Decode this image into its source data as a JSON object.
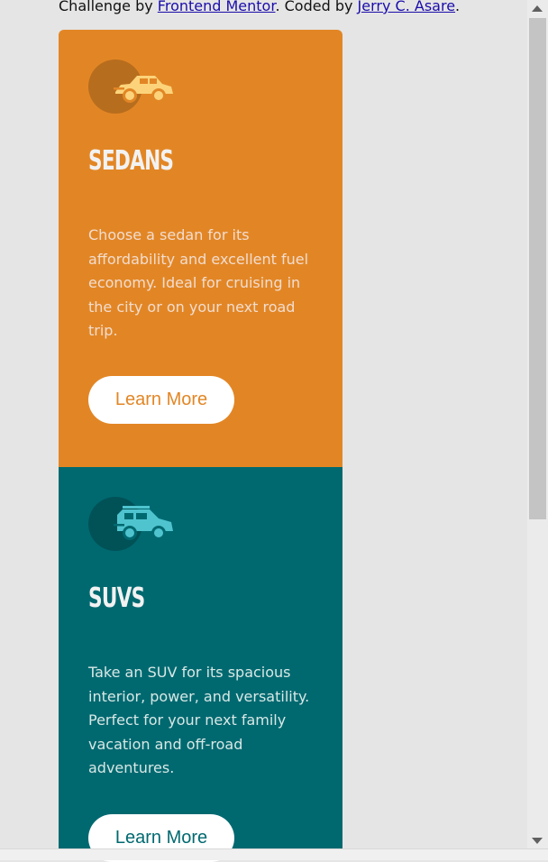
{
  "attribution": {
    "prefix": "Challenge by ",
    "link1": "Frontend Mentor",
    "middle": ". Coded by ",
    "link2": "Jerry C. Asare",
    "suffix": "."
  },
  "cards": [
    {
      "title": "SEDANS",
      "text": "Choose a sedan for its affordability and excellent fuel economy. Ideal for cruising in the city or on your next road trip.",
      "button": "Learn More",
      "icon": "sedan-car-icon",
      "color": "#e28625"
    },
    {
      "title": "SUVS",
      "text": "Take an SUV for its spacious interior, power, and versatility. Perfect for your next family vacation and off-road adventures.",
      "button": "Learn More",
      "icon": "suv-car-icon",
      "color": "#006970"
    }
  ]
}
